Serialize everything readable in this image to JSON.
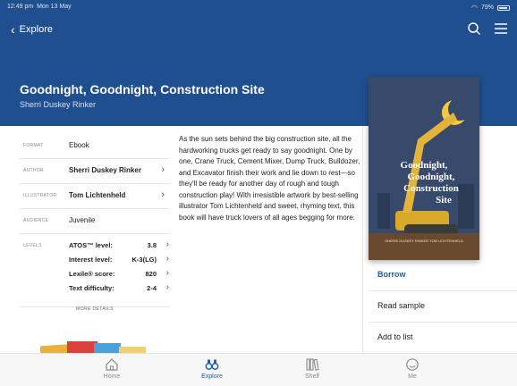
{
  "status_bar": {
    "time": "12:49 pm",
    "date": "Mon 13 May",
    "battery": "79%"
  },
  "nav": {
    "back_label": "Explore"
  },
  "book": {
    "title": "Goodnight, Goodnight, Construction Site",
    "author": "Sherri Duskey Rinker",
    "cover_title_lines": [
      "Goodnight,",
      "Goodnight,",
      "Construction",
      "Site"
    ],
    "cover_credits": "SHERRI DUSKEY RINKER  TOM LICHTENHELD"
  },
  "details": {
    "format_label": "FORMAT",
    "format_value": "Ebook",
    "author_label": "AUTHOR",
    "author_value": "Sherri Duskey Rinker",
    "illustrator_label": "ILLUSTRATOR",
    "illustrator_value": "Tom Lichtenheld",
    "audience_label": "AUDIENCE",
    "audience_value": "Juvenile",
    "levels_label": "LEVELS",
    "levels": [
      {
        "name": "ATOS™ level:",
        "value": "3.8"
      },
      {
        "name": "Interest level:",
        "value": "K-3(LG)"
      },
      {
        "name": "Lexile® score:",
        "value": "820"
      },
      {
        "name": "Text difficulty:",
        "value": "2-4"
      }
    ],
    "more_details": "MORE DETAILS"
  },
  "description": "As the sun sets behind the big construction site, all the hardworking trucks get ready to say goodnight. One by one, Crane Truck, Cement Mixer, Dump Truck, Bulldozer, and Excavator finish their work and lie down to rest—so they'll be ready for another day of rough and tough construction play! With irresistible artwork by best-selling illustrator Tom Lichtenheld and sweet, rhyming text, this book will have truck lovers of all ages begging for more.",
  "actions": {
    "borrow": "Borrow",
    "read_sample": "Read sample",
    "add_to_list": "Add to list"
  },
  "tabs": [
    {
      "label": "Home",
      "icon": "home-icon"
    },
    {
      "label": "Explore",
      "icon": "binoculars-icon"
    },
    {
      "label": "Shelf",
      "icon": "books-icon"
    },
    {
      "label": "Me",
      "icon": "smiley-icon"
    }
  ],
  "colors": {
    "header": "#1f4f8f",
    "accent": "#1f5fb3"
  }
}
